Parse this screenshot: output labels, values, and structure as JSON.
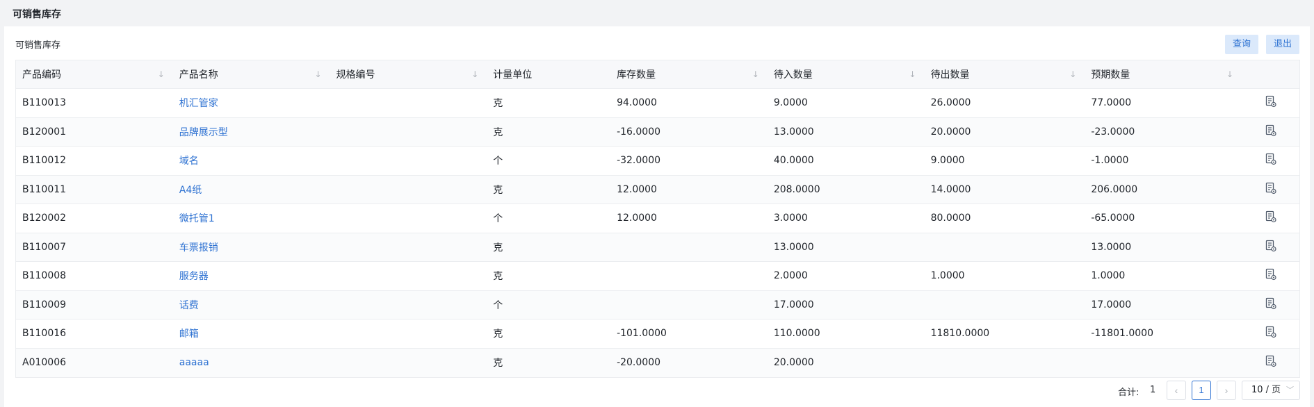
{
  "page": {
    "title": "可销售库存"
  },
  "card": {
    "title": "可销售库存",
    "buttons": {
      "query": "查询",
      "exit": "退出"
    }
  },
  "table": {
    "columns": [
      "产品编码",
      "产品名称",
      "规格编号",
      "计量单位",
      "库存数量",
      "待入数量",
      "待出数量",
      "预期数量"
    ],
    "sortable": [
      true,
      true,
      true,
      false,
      true,
      true,
      true,
      true
    ],
    "rows": [
      [
        "B110013",
        "机汇管家",
        "",
        "克",
        "94.0000",
        "9.0000",
        "26.0000",
        "77.0000"
      ],
      [
        "B120001",
        "品牌展示型",
        "",
        "克",
        "-16.0000",
        "13.0000",
        "20.0000",
        "-23.0000"
      ],
      [
        "B110012",
        "域名",
        "",
        "个",
        "-32.0000",
        "40.0000",
        "9.0000",
        "-1.0000"
      ],
      [
        "B110011",
        "A4纸",
        "",
        "克",
        "12.0000",
        "208.0000",
        "14.0000",
        "206.0000"
      ],
      [
        "B120002",
        "微托管1",
        "",
        "个",
        "12.0000",
        "3.0000",
        "80.0000",
        "-65.0000"
      ],
      [
        "B110007",
        "车票报销",
        "",
        "克",
        "",
        "13.0000",
        "",
        "13.0000"
      ],
      [
        "B110008",
        "服务器",
        "",
        "克",
        "",
        "2.0000",
        "1.0000",
        "1.0000"
      ],
      [
        "B110009",
        "话费",
        "",
        "个",
        "",
        "17.0000",
        "",
        "17.0000"
      ],
      [
        "B110016",
        "邮箱",
        "",
        "克",
        "-101.0000",
        "110.0000",
        "11810.0000",
        "-11801.0000"
      ],
      [
        "A010006",
        "aaaaa",
        "",
        "克",
        "-20.0000",
        "20.0000",
        "",
        ""
      ]
    ],
    "row_action_icon": "document-view-icon"
  },
  "pagination": {
    "total_label": "合计:",
    "total": "1",
    "current_page": "1",
    "page_size": "10 / 页"
  },
  "colors": {
    "accent": "#2e72d2",
    "button_bg": "#dbe9fb",
    "background": "#f2f3f5"
  }
}
